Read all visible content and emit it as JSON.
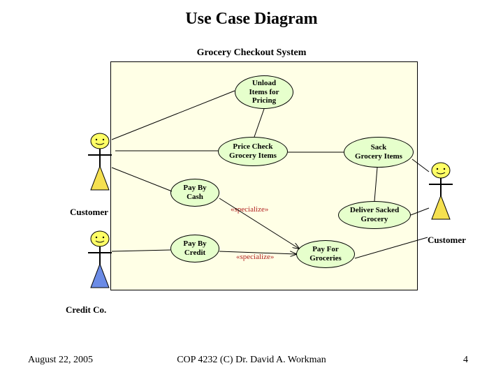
{
  "title": "Use Case Diagram",
  "system_name": "Grocery Checkout System",
  "usecases": {
    "unload": "Unload\nItems for\nPricing",
    "price_check": "Price Check\nGrocery Items",
    "sack": "Sack\nGrocery Items",
    "pay_cash": "Pay By\nCash",
    "deliver": "Deliver Sacked\nGrocery",
    "pay_credit": "Pay By\nCredit",
    "pay_for": "Pay For\nGroceries"
  },
  "stereotypes": {
    "specialize1": "«specialize»",
    "specialize2": "«specialize»"
  },
  "actors": {
    "customer_left": "Customer",
    "customer_right": "Customer",
    "credit_co": "Credit Co."
  },
  "footer": {
    "date": "August 22, 2005",
    "center": "COP 4232  (C) Dr. David A. Workman",
    "page": "4"
  },
  "colors": {
    "system_bg": "#FFFFE6",
    "usecase_bg": "#E6FFCC",
    "actor_head": "#FFFF66",
    "actor_body_blue": "#6B8BE6",
    "actor_body_yellow": "#F5E050",
    "stereo": "#B22222"
  }
}
